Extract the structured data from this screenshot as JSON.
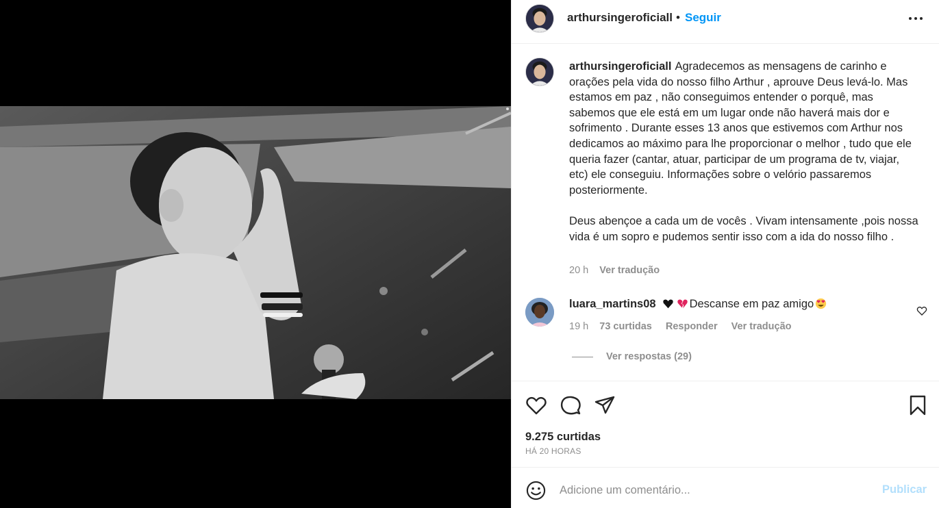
{
  "post": {
    "username": "arthursingeroficiall",
    "separator": "•",
    "follow_label": "Seguir",
    "caption_username": "arthursingeroficiall",
    "caption_text": "Agradecemos as mensagens de carinho e orações pela vida do nosso filho Arthur , aprouve Deus levá-lo. Mas estamos em paz , não conseguimos entender o porquê, mas sabemos que ele está em um lugar onde não haverá mais dor e sofrimento . Durante esses 13 anos que estivemos com Arthur nos dedicamos ao máximo para lhe proporcionar o melhor , tudo que ele queria fazer (cantar, atuar, participar de um programa de tv, viajar, etc) ele conseguiu. Informações sobre o velório passaremos posteriormente.\n\nDeus abençoe a cada um de vocês . Vivam intensamente ,pois nossa vida é um sopro e pudemos sentir isso com a ida do nosso filho .",
    "caption_time": "20 h",
    "caption_translate": "Ver tradução"
  },
  "comment": {
    "username": "luara_martins08",
    "text": "Descanse em paz amigo",
    "emojis": [
      "black-heart-icon",
      "broken-heart-icon",
      "heart-eyes-icon"
    ],
    "time": "19 h",
    "likes": "73 curtidas",
    "reply": "Responder",
    "translate": "Ver tradução",
    "view_replies": "Ver respostas (29)"
  },
  "actions": {
    "likes_count": "9.275 curtidas",
    "time_ago": "HÁ 20 HORAS"
  },
  "add_comment": {
    "placeholder": "Adicione um comentário...",
    "post_label": "Publicar"
  },
  "colors": {
    "accent": "#0095f6",
    "accent_disabled": "#b2dffc",
    "muted": "#8e8e8e",
    "text": "#262626"
  }
}
